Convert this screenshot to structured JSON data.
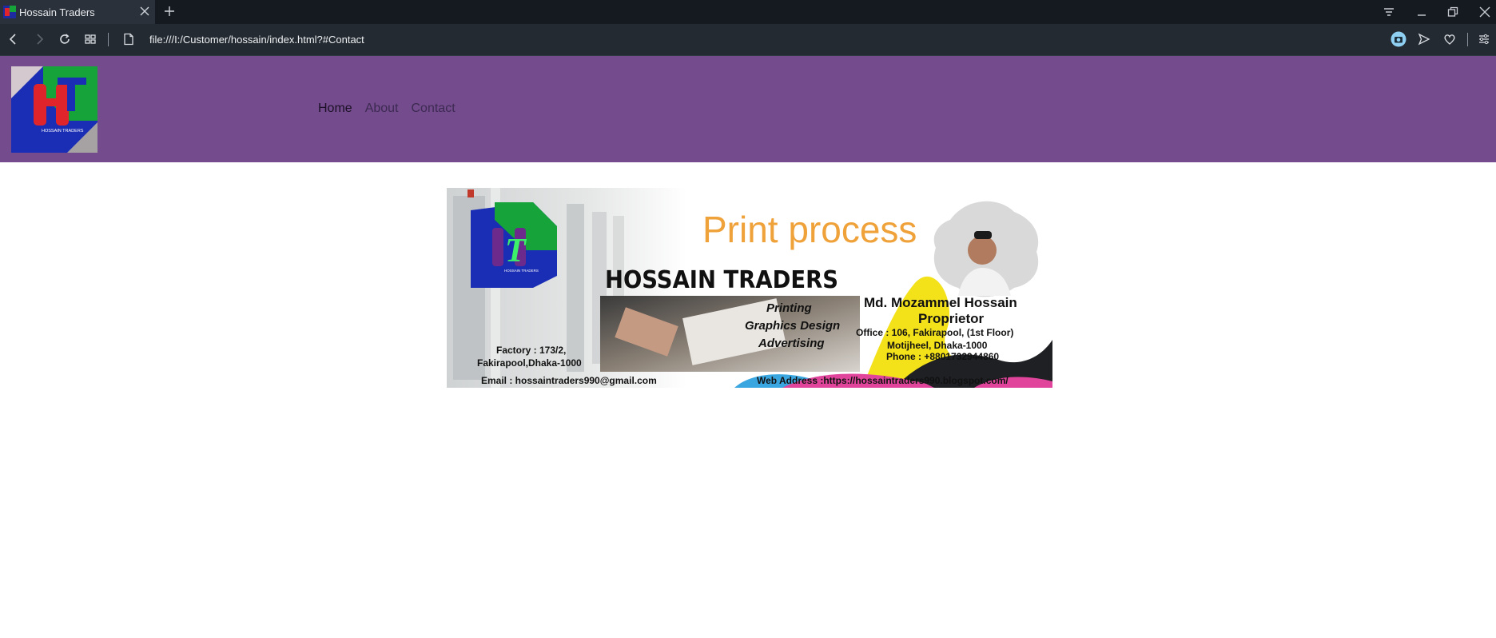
{
  "browser": {
    "tab_title": "Hossain Traders",
    "url": "file:///I:/Customer/hossain/index.html?#Contact"
  },
  "nav": {
    "items": [
      "Home",
      "About",
      "Contact"
    ]
  },
  "banner": {
    "headline": "Print process",
    "company": "HOSSAIN TRADERS",
    "services": [
      "Printing",
      "Graphics Design",
      "Advertising"
    ],
    "proprietor_name": "Md. Mozammel Hossain",
    "proprietor_title": "Proprietor",
    "office_line1": "Office :  106, Fakirapool, (1st Floor)",
    "office_line2": "Motijheel, Dhaka-1000",
    "phone": "Phone : +8801732944860",
    "factory_line1": "Factory : 173/2,",
    "factory_line2": "Fakirapool,Dhaka-1000",
    "email": "Email : hossaintraders990@gmail.com",
    "web": "Web Address :https://hossaintraders990.blogspot.com/",
    "logo_caption": "HOSSAIN TRADERS"
  },
  "header_logo_caption": "HOSSAIN TRADERS",
  "colors": {
    "header_bg": "#744b8c",
    "accent_orange": "#f0a23a",
    "logo_green": "#15a33a",
    "logo_blue": "#1a2db5",
    "logo_red": "#e0242c"
  }
}
